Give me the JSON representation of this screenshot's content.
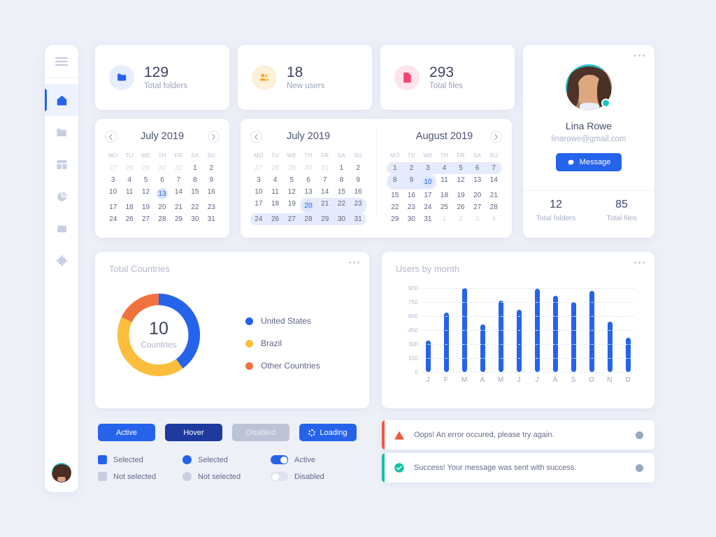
{
  "sidebar": {
    "menu_icon": "hamburger-menu-icon",
    "items": [
      {
        "name": "home",
        "icon": "home-icon",
        "active": true
      },
      {
        "name": "folders",
        "icon": "folder-icon",
        "active": false
      },
      {
        "name": "layout",
        "icon": "layout-grid-icon",
        "active": false
      },
      {
        "name": "analytics",
        "icon": "pie-chart-icon",
        "active": false
      },
      {
        "name": "archive",
        "icon": "box-icon",
        "active": false
      },
      {
        "name": "extensions",
        "icon": "puzzle-piece-icon",
        "active": false
      }
    ],
    "avatar": "user-avatar"
  },
  "stats": [
    {
      "value": "129",
      "label": "Total folders",
      "icon": "folder-icon",
      "color": "#2563eb",
      "bg": "#e6edfd"
    },
    {
      "value": "18",
      "label": "New users",
      "icon": "users-icon",
      "color": "#f5a623",
      "bg": "#fdf0da"
    },
    {
      "value": "293",
      "label": "Total files",
      "icon": "file-icon",
      "color": "#f4436c",
      "bg": "#fde3ea"
    }
  ],
  "calendars": [
    {
      "title": "July 2019",
      "weekdays": [
        "MO",
        "TU",
        "WE",
        "TH",
        "FR",
        "SA",
        "SU"
      ],
      "prev": true,
      "next": true,
      "weeks": [
        [
          {
            "d": "27",
            "mut": true
          },
          {
            "d": "28",
            "mut": true
          },
          {
            "d": "29",
            "mut": true
          },
          {
            "d": "30",
            "mut": true
          },
          {
            "d": "31",
            "mut": true
          },
          {
            "d": "1"
          },
          {
            "d": "2"
          }
        ],
        [
          {
            "d": "3"
          },
          {
            "d": "4"
          },
          {
            "d": "5"
          },
          {
            "d": "6"
          },
          {
            "d": "7"
          },
          {
            "d": "8"
          },
          {
            "d": "9"
          }
        ],
        [
          {
            "d": "10"
          },
          {
            "d": "11"
          },
          {
            "d": "12"
          },
          {
            "d": "13",
            "sel": true
          },
          {
            "d": "14"
          },
          {
            "d": "15"
          },
          {
            "d": "16"
          }
        ],
        [
          {
            "d": "17"
          },
          {
            "d": "18"
          },
          {
            "d": "19"
          },
          {
            "d": "20"
          },
          {
            "d": "21"
          },
          {
            "d": "22"
          },
          {
            "d": "23"
          }
        ],
        [
          {
            "d": "24"
          },
          {
            "d": "26"
          },
          {
            "d": "27"
          },
          {
            "d": "28"
          },
          {
            "d": "29"
          },
          {
            "d": "30"
          },
          {
            "d": "31"
          }
        ]
      ]
    },
    {
      "title": "July 2019",
      "weekdays": [
        "MO",
        "TU",
        "WE",
        "TH",
        "FR",
        "SA",
        "SU"
      ],
      "prev": true,
      "next": false,
      "weeks": [
        [
          {
            "d": "27",
            "mut": true
          },
          {
            "d": "28",
            "mut": true
          },
          {
            "d": "29",
            "mut": true
          },
          {
            "d": "30",
            "mut": true
          },
          {
            "d": "31",
            "mut": true
          },
          {
            "d": "1"
          },
          {
            "d": "2"
          }
        ],
        [
          {
            "d": "3"
          },
          {
            "d": "4"
          },
          {
            "d": "5"
          },
          {
            "d": "6"
          },
          {
            "d": "7"
          },
          {
            "d": "8"
          },
          {
            "d": "9"
          }
        ],
        [
          {
            "d": "10"
          },
          {
            "d": "11"
          },
          {
            "d": "12"
          },
          {
            "d": "13"
          },
          {
            "d": "14"
          },
          {
            "d": "15"
          },
          {
            "d": "16"
          }
        ],
        [
          {
            "d": "17"
          },
          {
            "d": "18"
          },
          {
            "d": "19"
          },
          {
            "d": "20",
            "sel": true,
            "range": true,
            "rs": true
          },
          {
            "d": "21",
            "range": true
          },
          {
            "d": "22",
            "range": true
          },
          {
            "d": "23",
            "range": true,
            "re": true
          }
        ],
        [
          {
            "d": "24",
            "range": true,
            "rs": true
          },
          {
            "d": "26",
            "range": true
          },
          {
            "d": "27",
            "range": true
          },
          {
            "d": "28",
            "range": true
          },
          {
            "d": "29",
            "range": true
          },
          {
            "d": "30",
            "range": true
          },
          {
            "d": "31",
            "range": true,
            "re": true
          }
        ]
      ]
    },
    {
      "title": "August 2019",
      "weekdays": [
        "MO",
        "TU",
        "WE",
        "TH",
        "FR",
        "SA",
        "SU"
      ],
      "prev": false,
      "next": true,
      "weeks": [
        [
          {
            "d": "1",
            "range": true,
            "rs": true
          },
          {
            "d": "2",
            "range": true
          },
          {
            "d": "3",
            "range": true
          },
          {
            "d": "4",
            "range": true
          },
          {
            "d": "5",
            "range": true
          },
          {
            "d": "6",
            "range": true
          },
          {
            "d": "7",
            "range": true,
            "re": true
          }
        ],
        [
          {
            "d": "8",
            "range": true,
            "rs": true
          },
          {
            "d": "9",
            "range": true
          },
          {
            "d": "10",
            "sel": true,
            "range": true,
            "re": true
          },
          {
            "d": "11"
          },
          {
            "d": "12"
          },
          {
            "d": "13"
          },
          {
            "d": "14"
          }
        ],
        [
          {
            "d": "15"
          },
          {
            "d": "16"
          },
          {
            "d": "17"
          },
          {
            "d": "18"
          },
          {
            "d": "19"
          },
          {
            "d": "20"
          },
          {
            "d": "21"
          }
        ],
        [
          {
            "d": "22"
          },
          {
            "d": "23"
          },
          {
            "d": "24"
          },
          {
            "d": "25"
          },
          {
            "d": "26"
          },
          {
            "d": "27"
          },
          {
            "d": "28"
          }
        ],
        [
          {
            "d": "29"
          },
          {
            "d": "30"
          },
          {
            "d": "31"
          },
          {
            "d": "1",
            "mut": true
          },
          {
            "d": "2",
            "mut": true
          },
          {
            "d": "3",
            "mut": true
          },
          {
            "d": "4",
            "mut": true
          }
        ]
      ]
    }
  ],
  "profile": {
    "name": "Lina Rowe",
    "email": "linarowe@gmail.com",
    "message_button": "Message",
    "status": "online",
    "stats": [
      {
        "value": "12",
        "label": "Total folders"
      },
      {
        "value": "85",
        "label": "Total files"
      }
    ]
  },
  "donut_card": {
    "title": "Total Countries"
  },
  "bar_card": {
    "title": "Users by month"
  },
  "chart_data": [
    {
      "type": "pie",
      "title": "Total Countries",
      "center_value": "10",
      "center_label": "Countries",
      "labels": [
        "United States",
        "Brazil",
        "Other Countries"
      ],
      "values": [
        40,
        42,
        18
      ],
      "colors": [
        "#2563eb",
        "#fbbe3c",
        "#f2723f"
      ],
      "legend": "right"
    },
    {
      "type": "bar",
      "title": "Users by month",
      "categories": [
        "J",
        "F",
        "M",
        "A",
        "M",
        "J",
        "J",
        "A",
        "S",
        "O",
        "N",
        "D"
      ],
      "values": [
        340,
        640,
        900,
        510,
        765,
        670,
        895,
        820,
        750,
        870,
        540,
        365
      ],
      "ytick_labels": [
        "0",
        "150",
        "300",
        "450",
        "600",
        "750",
        "900"
      ],
      "yticks": [
        0,
        150,
        300,
        450,
        600,
        750,
        900
      ],
      "ylim": [
        0,
        900
      ],
      "xlabel": "",
      "ylabel": "",
      "grid": true,
      "series_color": "#2563eb"
    }
  ],
  "buttons": [
    {
      "label": "Active",
      "state": "active"
    },
    {
      "label": "Hover",
      "state": "hover"
    },
    {
      "label": "Disabled",
      "state": "disabled"
    },
    {
      "label": "Loading",
      "state": "loading",
      "icon": "spinner-icon"
    }
  ],
  "controls": {
    "checkboxes": [
      {
        "label": "Selected",
        "checked": true
      },
      {
        "label": "Not selected",
        "checked": false
      }
    ],
    "radios": [
      {
        "label": "Selected",
        "checked": true
      },
      {
        "label": "Not selected",
        "checked": false
      }
    ],
    "toggles": [
      {
        "label": "Active",
        "on": true
      },
      {
        "label": "Disabled",
        "on": false
      }
    ]
  },
  "alerts": [
    {
      "type": "error",
      "text": "Oops! An error occured, please try again.",
      "color": "#f4563f",
      "icon": "warning-triangle-icon"
    },
    {
      "type": "success",
      "text": "Success! Your message was sent with success.",
      "color": "#14c3a2",
      "icon": "check-circle-icon"
    }
  ]
}
